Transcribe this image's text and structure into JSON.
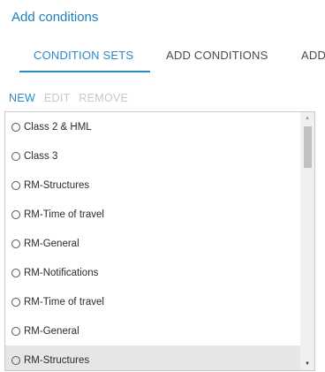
{
  "header": {
    "title": "Add conditions"
  },
  "tabs": [
    {
      "label": "CONDITION SETS",
      "active": true
    },
    {
      "label": "ADD CONDITIONS",
      "active": false
    },
    {
      "label": "ADD",
      "active": false
    }
  ],
  "toolbar": {
    "new_label": "NEW",
    "edit_label": "EDIT",
    "remove_label": "REMOVE"
  },
  "condition_sets": [
    {
      "label": "Class 2 & HML"
    },
    {
      "label": "Class 3"
    },
    {
      "label": "RM-Structures"
    },
    {
      "label": "RM-Time of travel"
    },
    {
      "label": "RM-General"
    },
    {
      "label": "RM-Notifications"
    },
    {
      "label": "RM-Time of travel"
    },
    {
      "label": "RM-General"
    },
    {
      "label": "RM-Structures"
    }
  ],
  "icons": {
    "scroll_up": "▲",
    "scroll_down": "▼"
  },
  "colors": {
    "accent": "#2a8bc4",
    "title": "#1f7fbd",
    "disabled": "#c8c8c8",
    "highlight": "#e6e6e6"
  }
}
